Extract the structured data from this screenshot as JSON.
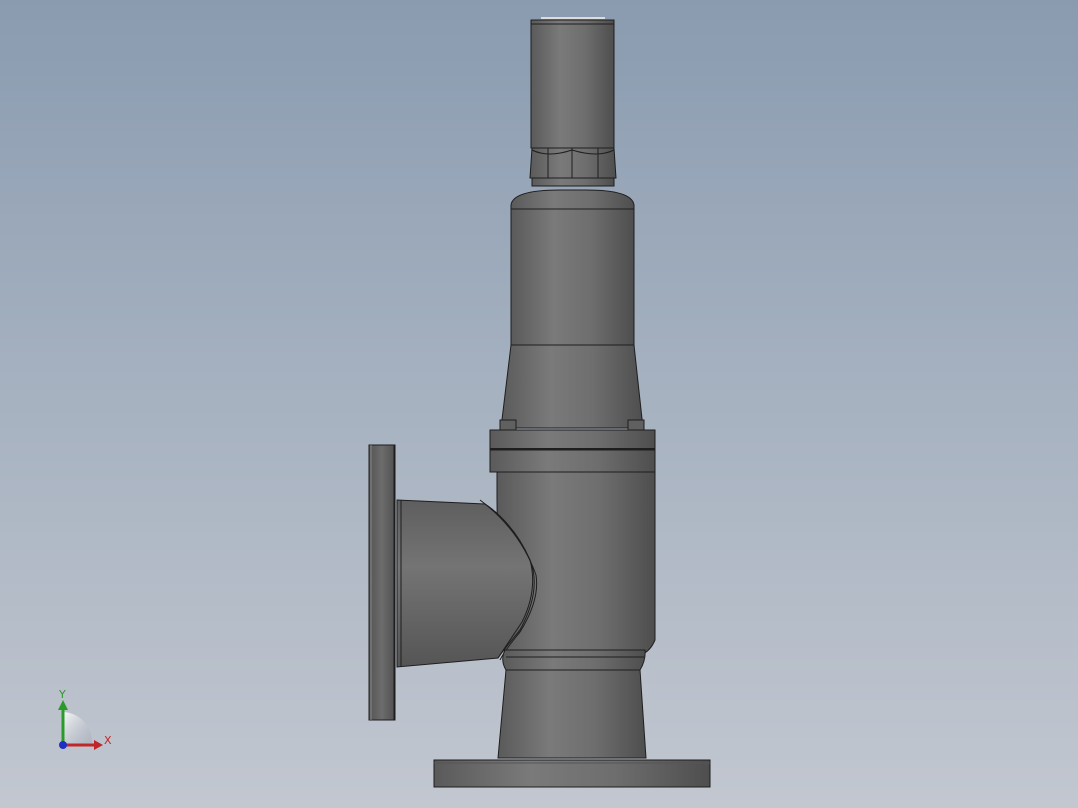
{
  "viewport": {
    "background_top": "#8a9bb0",
    "background_bottom": "#c2c7d0"
  },
  "model": {
    "name_visible": false,
    "body_color": "#6a6a6a",
    "edge_color": "#1e1e1e",
    "highlight_color": "#8a8a8a",
    "shadow_color": "#4a4a4a"
  },
  "triad": {
    "x_label": "X",
    "y_label": "Y",
    "x_color": "#c0262a",
    "y_color": "#2a9a2a",
    "z_color": "#2030c0"
  }
}
